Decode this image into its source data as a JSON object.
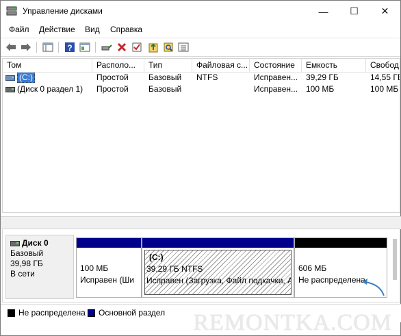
{
  "window": {
    "title": "Управление дисками",
    "min_glyph": "—",
    "max_glyph": "☐",
    "close_glyph": "✕"
  },
  "menu": [
    "Файл",
    "Действие",
    "Вид",
    "Справка"
  ],
  "toolbar_icons": [
    "back-arrow-icon",
    "forward-arrow-icon",
    "console-tree-icon",
    "help-icon",
    "properties-icon",
    "connect-icon",
    "delete-icon",
    "check-icon",
    "refresh-icon",
    "search-icon",
    "list-icon"
  ],
  "columns": [
    "Том",
    "Располо...",
    "Тип",
    "Файловая с...",
    "Состояние",
    "Емкость",
    "Свобод"
  ],
  "rows": [
    {
      "volume": "(C:)",
      "layout": "Простой",
      "type": "Базовый",
      "fs": "NTFS",
      "status": "Исправен...",
      "capacity": "39,29 ГБ",
      "free": "14,55 ГБ",
      "selected": true
    },
    {
      "volume": "(Диск 0 раздел 1)",
      "layout": "Простой",
      "type": "Базовый",
      "fs": "",
      "status": "Исправен...",
      "capacity": "100 МБ",
      "free": "100 МБ",
      "selected": false
    }
  ],
  "disk": {
    "name": "Диск 0",
    "type": "Базовый",
    "size": "39,98 ГБ",
    "state": "В сети"
  },
  "partitions": [
    {
      "title": "",
      "size": "100 МБ",
      "status": "Исправен (Ши"
    },
    {
      "title": "(C:)",
      "size": "39,29 ГБ NTFS",
      "status": "Исправен (Загрузка, Файл подкачки, А"
    },
    {
      "title": "",
      "size": "606 МБ",
      "status": "Не распределена"
    }
  ],
  "legend": [
    {
      "label": "Не распределена",
      "color": "#000000"
    },
    {
      "label": "Основной раздел",
      "color": "#00008b"
    }
  ],
  "watermark": "REMONTKA.COM",
  "colors": {
    "primary_bar": "#00008b",
    "unallocated_bar": "#000000",
    "selection": "#3a7bd5",
    "arrow": "#3b7fc4"
  }
}
